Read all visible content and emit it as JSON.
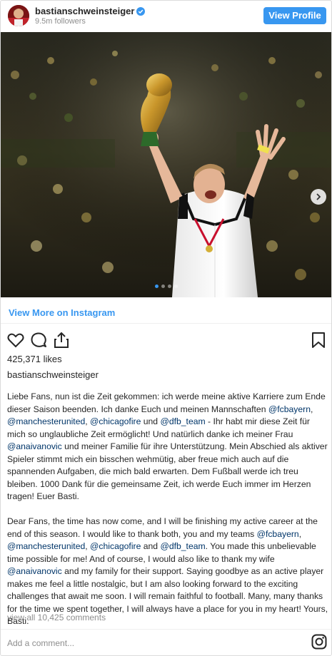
{
  "header": {
    "username": "bastianschweinsteiger",
    "followers": "9.5m followers",
    "view_profile": "View Profile"
  },
  "post": {
    "view_more": "View More on Instagram",
    "likes": "425,371 likes",
    "author": "bastianschweinsteiger",
    "caption_de": {
      "p1": "Liebe Fans, nun ist die Zeit gekommen: ich werde meine aktive Karriere zum Ende dieser Saison beenden. Ich danke Euch und meinen Mannschaften ",
      "m1": "@fcbayern",
      "s1": ", ",
      "m2": "@manchesterunited",
      "s2": ", ",
      "m3": "@chicagofire",
      "s3": " und ",
      "m4": "@dfb_team",
      "p2": " - Ihr habt mir diese Zeit für mich so unglaubliche Zeit ermöglicht! Und natürlich danke ich meiner Frau ",
      "m5": "@anaivanovic",
      "p3": " und meiner Familie für ihre Unterstützung. Mein Abschied als aktiver Spieler stimmt mich ein bisschen wehmütig, aber freue mich auch auf die spannenden Aufgaben, die mich bald erwarten. Dem Fußball werde ich treu bleiben. 1000 Dank für die gemeinsame Zeit, ich werde Euch immer im Herzen tragen! Euer Basti."
    },
    "caption_en": {
      "p1": "Dear Fans, the time has now come, and I will be finishing my active career at the end of this season. I would like to thank both, you and my teams ",
      "m1": "@fcbayern",
      "s1": ", ",
      "m2": "@manchesterunited",
      "s2": ", ",
      "m3": "@chicagofire",
      "s3": " and ",
      "m4": "@dfb_team",
      "p2": ". You made this unbelievable time possible for me! And of course, I would also like to thank my wife ",
      "m5": "@anaivanovic",
      "p3": " and my family for their support. Saying goodbye as an active player makes me feel a little nostalgic, but I am also looking forward to the exciting challenges that await me soon. I will remain faithful to football. Many, many thanks for the time we spent together, I will always have a place for you in my heart! Yours, Basti."
    },
    "view_comments": "view all 10,425 comments",
    "add_comment_placeholder": "Add a comment..."
  },
  "carousel": {
    "slide_count": 4,
    "active_slide": 1
  },
  "colors": {
    "accent": "#3897f0",
    "mention": "#003569",
    "muted": "#8e8e8e"
  },
  "icons": [
    "verified-badge-icon",
    "heart-icon",
    "comment-icon",
    "share-icon",
    "bookmark-icon",
    "chevron-right-icon",
    "instagram-icon"
  ]
}
